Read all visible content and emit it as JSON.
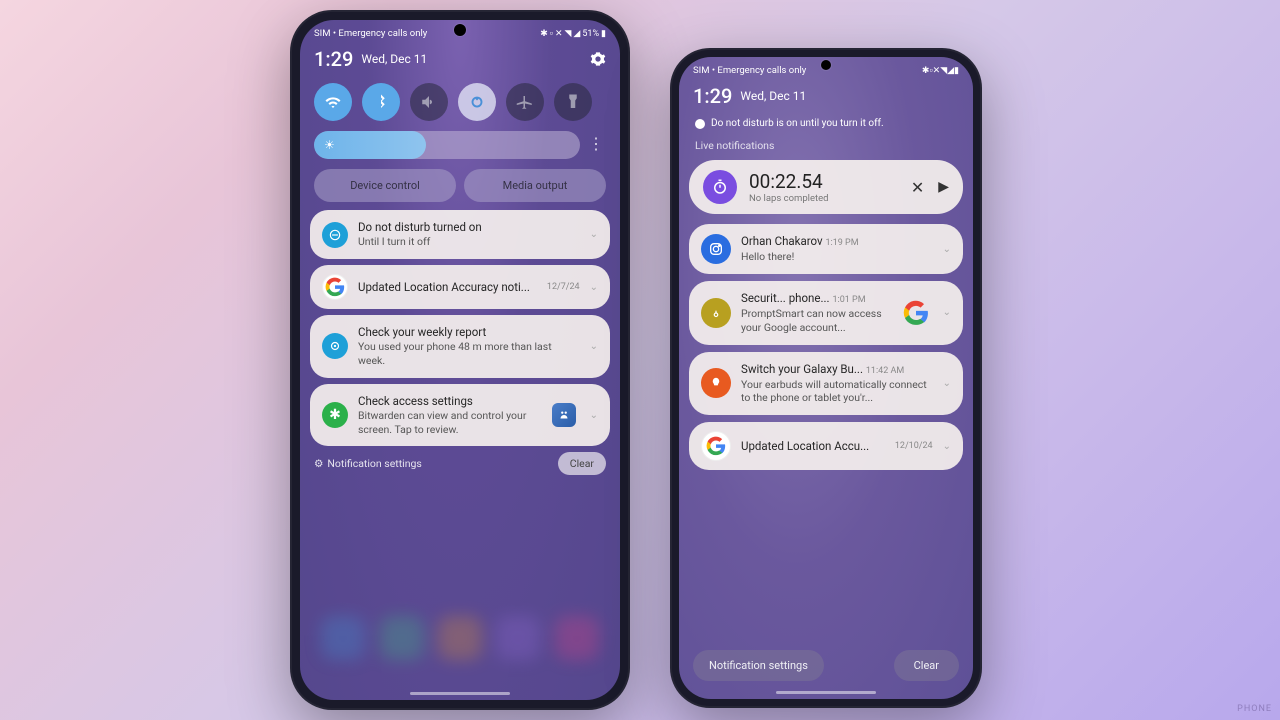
{
  "watermark": "PHONE",
  "left": {
    "status": {
      "carrier": "SIM • Emergency calls only",
      "battery": "51%"
    },
    "clock": {
      "time": "1:29",
      "date": "Wed, Dec 11"
    },
    "pills": {
      "device_control": "Device control",
      "media_output": "Media output"
    },
    "notifications": [
      {
        "title": "Do not disturb turned on",
        "subtitle": "Until I turn it off"
      },
      {
        "title": "Updated Location Accuracy noti...",
        "time": "12/7/24"
      },
      {
        "title": "Check your weekly report",
        "subtitle": "You used your phone 48 m more than last week."
      },
      {
        "title": "Check access settings",
        "subtitle": "Bitwarden can view and control your screen. Tap to review."
      }
    ],
    "bottom": {
      "settings": "Notification settings",
      "clear": "Clear"
    }
  },
  "right": {
    "status": {
      "carrier": "SIM • Emergency calls only"
    },
    "clock": {
      "time": "1:29",
      "date": "Wed, Dec 11"
    },
    "dnd_line": "Do not disturb is on until you turn it off.",
    "live_label": "Live notifications",
    "stopwatch": {
      "time": "00:22.54",
      "sub": "No laps completed"
    },
    "notifications": [
      {
        "title": "Orhan Chakarov",
        "subtitle": "Hello there!",
        "time": "1:19 PM"
      },
      {
        "title": "Securit...    phone...",
        "subtitle": "PromptSmart can now access your Google account...",
        "time": "1:01 PM"
      },
      {
        "title": "Switch your Galaxy Bu...",
        "subtitle": "Your earbuds will automatically connect to the phone or tablet you'r...",
        "time": "11:42 AM"
      },
      {
        "title": "Updated Location Accu...",
        "time": "12/10/24"
      }
    ],
    "bottom": {
      "settings": "Notification settings",
      "clear": "Clear"
    }
  }
}
